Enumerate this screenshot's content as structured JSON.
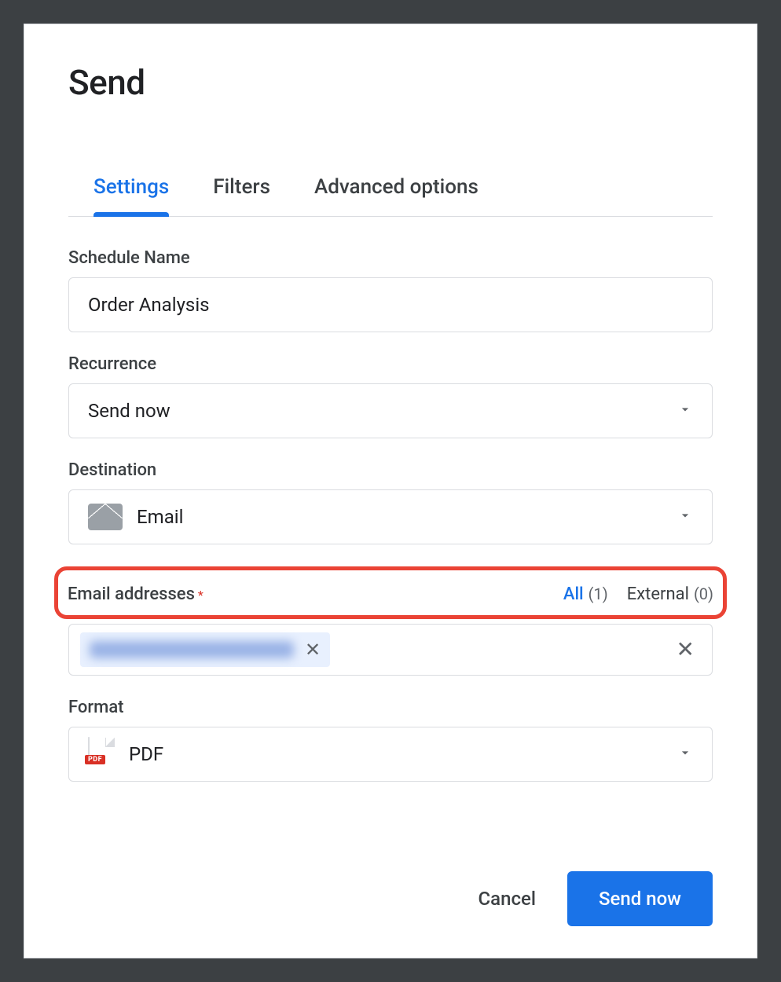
{
  "dialog": {
    "title": "Send"
  },
  "tabs": {
    "settings": "Settings",
    "filters": "Filters",
    "advanced": "Advanced options"
  },
  "scheduleName": {
    "label": "Schedule Name",
    "value": "Order Analysis"
  },
  "recurrence": {
    "label": "Recurrence",
    "value": "Send now"
  },
  "destination": {
    "label": "Destination",
    "value": "Email"
  },
  "emailAddresses": {
    "label": "Email addresses",
    "required": "*",
    "allLabel": "All",
    "allCount": "(1)",
    "externalLabel": "External",
    "externalCount": "(0)"
  },
  "format": {
    "label": "Format",
    "value": "PDF",
    "badge": "PDF"
  },
  "footer": {
    "cancel": "Cancel",
    "sendNow": "Send now"
  }
}
